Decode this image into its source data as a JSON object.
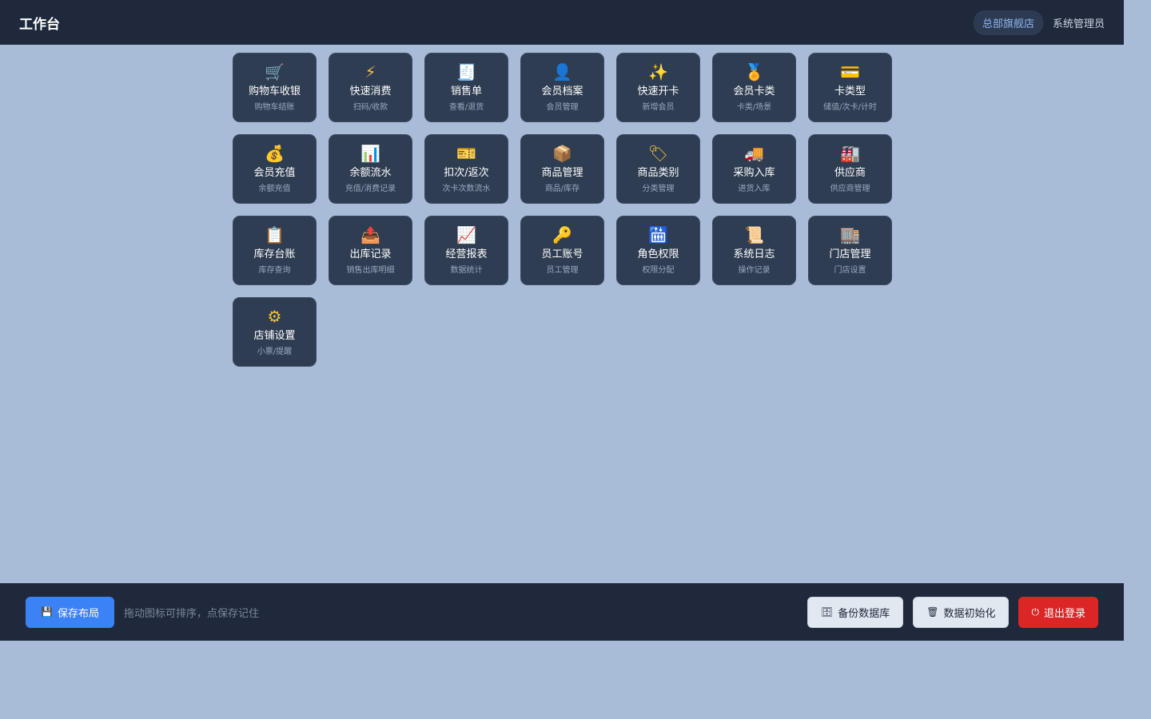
{
  "header": {
    "title": "工作台",
    "store": "总部旗舰店",
    "user": "系统管理员"
  },
  "tiles": [
    {
      "label": "购物车收银",
      "sub": "购物车结账",
      "icon": "🛒",
      "name": "cart-icon"
    },
    {
      "label": "快速消费",
      "sub": "扫码/收款",
      "icon": "⚡",
      "name": "lightning-icon"
    },
    {
      "label": "销售单",
      "sub": "查看/退货",
      "icon": "🧾",
      "name": "receipt-icon"
    },
    {
      "label": "会员档案",
      "sub": "会员管理",
      "icon": "👤",
      "name": "person-icon"
    },
    {
      "label": "快速开卡",
      "sub": "新增会员",
      "icon": "✨",
      "name": "sparkles-icon"
    },
    {
      "label": "会员卡类",
      "sub": "卡类/场景",
      "icon": "🏅",
      "name": "medal-icon"
    },
    {
      "label": "卡类型",
      "sub": "储值/次卡/计时",
      "icon": "💳",
      "name": "credit-card-icon"
    },
    {
      "label": "会员充值",
      "sub": "余额充值",
      "icon": "💰",
      "name": "money-bag-icon"
    },
    {
      "label": "余额流水",
      "sub": "充值/消费记录",
      "icon": "📊",
      "name": "bar-chart-icon"
    },
    {
      "label": "扣次/返次",
      "sub": "次卡次数流水",
      "icon": "🎫",
      "name": "ticket-icon"
    },
    {
      "label": "商品管理",
      "sub": "商品/库存",
      "icon": "📦",
      "name": "package-icon"
    },
    {
      "label": "商品类别",
      "sub": "分类管理",
      "icon": "🏷",
      "name": "tag-icon"
    },
    {
      "label": "采购入库",
      "sub": "进货入库",
      "icon": "🚚",
      "name": "truck-icon"
    },
    {
      "label": "供应商",
      "sub": "供应商管理",
      "icon": "🏭",
      "name": "factory-icon"
    },
    {
      "label": "库存台账",
      "sub": "库存查询",
      "icon": "📋",
      "name": "clipboard-icon"
    },
    {
      "label": "出库记录",
      "sub": "销售出库明细",
      "icon": "📤",
      "name": "outbox-icon"
    },
    {
      "label": "经营报表",
      "sub": "数据统计",
      "icon": "📈",
      "name": "line-chart-icon"
    },
    {
      "label": "员工账号",
      "sub": "员工管理",
      "icon": "🔑",
      "name": "key-icon"
    },
    {
      "label": "角色权限",
      "sub": "权限分配",
      "icon": "🛗",
      "name": "elevator-icon"
    },
    {
      "label": "系统日志",
      "sub": "操作记录",
      "icon": "📜",
      "name": "scroll-icon"
    },
    {
      "label": "门店管理",
      "sub": "门店设置",
      "icon": "🏬",
      "name": "store-icon"
    },
    {
      "label": "店铺设置",
      "sub": "小票/提醒",
      "icon": "⚙",
      "name": "gear-icon"
    }
  ],
  "footer": {
    "save_label": "保存布局",
    "save_icon": "💾",
    "hint": "拖动图标可排序，点保存记住",
    "backup_label": "备份数据库",
    "backup_icon": "🗄",
    "init_label": "数据初始化",
    "init_icon": "🗑",
    "logout_label": "退出登录",
    "logout_icon": "⏻"
  },
  "colors": {
    "background": "#a8bcd7",
    "bar": "#1f293b",
    "tile": "#2f3d52",
    "accent": "#3b82f6",
    "danger": "#dc2626"
  }
}
